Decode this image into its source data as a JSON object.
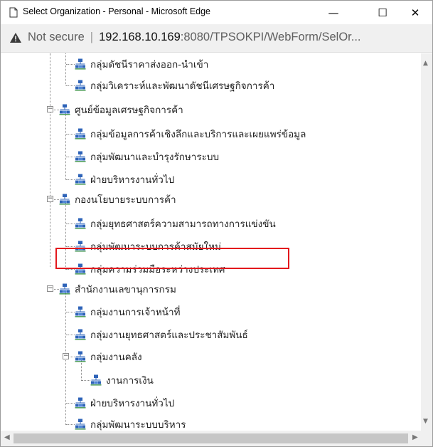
{
  "window": {
    "title": "Select Organization - Personal - Microsoft Edge",
    "minimize_glyph": "—",
    "maximize_glyph": "☐",
    "close_glyph": "✕"
  },
  "address_bar": {
    "security_label": "Not secure",
    "host": "192.168.10.169",
    "port_path": ":8080/TPSOKPI/WebForm/SelOr..."
  },
  "tree": {
    "nodes": [
      {
        "label": "กลุ่มดัชนีราคาส่งออก-นำเข้า"
      },
      {
        "label": "กลุ่มวิเคราะห์และพัฒนาดัชนีเศรษฐกิจการค้า"
      },
      {
        "label": "ศูนย์ข้อมูลเศรษฐกิจการค้า"
      },
      {
        "label": "กลุ่มข้อมูลการค้าเชิงลึกและบริการและเผยแพร่ข้อมูล"
      },
      {
        "label": "กลุ่มพัฒนาและบำรุงรักษาระบบ"
      },
      {
        "label": "ฝ่ายบริหารงานทั่วไป"
      },
      {
        "label": "กองนโยบายระบบการค้า"
      },
      {
        "label": "กลุ่มยุทธศาสตร์ความสามารถทางการแข่งขัน"
      },
      {
        "label": "กลุ่มพัฒนาระบบการค้าสมัยใหม่"
      },
      {
        "label": "กลุ่มความร่วมมือระหว่างประเทศ"
      },
      {
        "label": "สำนักงานเลขานุการกรม"
      },
      {
        "label": "กลุ่มงานการเจ้าหน้าที่"
      },
      {
        "label": "กลุ่มงานยุทธศาสตร์และประชาสัมพันธ์"
      },
      {
        "label": "กลุ่มงานคลัง"
      },
      {
        "label": "งานการเงิน"
      },
      {
        "label": "ฝ่ายบริหารงานทั่วไป"
      },
      {
        "label": "กลุ่มพัฒนาระบบบริหาร"
      }
    ]
  },
  "colors": {
    "highlight": "#e3181d",
    "org_icon": "#2e63b8"
  },
  "icons": {
    "node": "org-chart-icon",
    "collapse": "collapse-minus-icon"
  }
}
